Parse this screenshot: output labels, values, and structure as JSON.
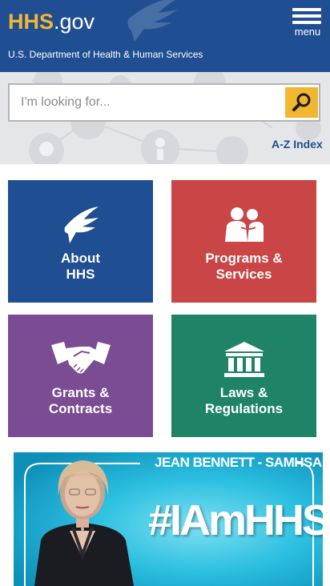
{
  "header": {
    "logo_hhs": "HHS",
    "logo_gov": ".gov",
    "department": "U.S. Department of Health & Human Services",
    "menu_label": "menu"
  },
  "search": {
    "placeholder": "I'm looking for...",
    "value": "",
    "az_index": "A-Z Index"
  },
  "tiles": [
    {
      "line1": "About",
      "line2": "HHS",
      "icon": "eagle-icon",
      "color": "#1f4e92"
    },
    {
      "line1": "Programs &",
      "line2": "Services",
      "icon": "people-icon",
      "color": "#c94546"
    },
    {
      "line1": "Grants &",
      "line2": "Contracts",
      "icon": "handshake-icon",
      "color": "#7a4c93"
    },
    {
      "line1": "Laws &",
      "line2": "Regulations",
      "icon": "building-icon",
      "color": "#1f8466"
    }
  ],
  "banner": {
    "caption": "JEAN BENNETT - SAMHSA",
    "hashtag": "#IAmHHS"
  },
  "colors": {
    "header_bg": "#1f4e92",
    "logo_accent": "#f4b434",
    "search_button": "#f1b730",
    "banner_bg": "#1bb6d9"
  }
}
